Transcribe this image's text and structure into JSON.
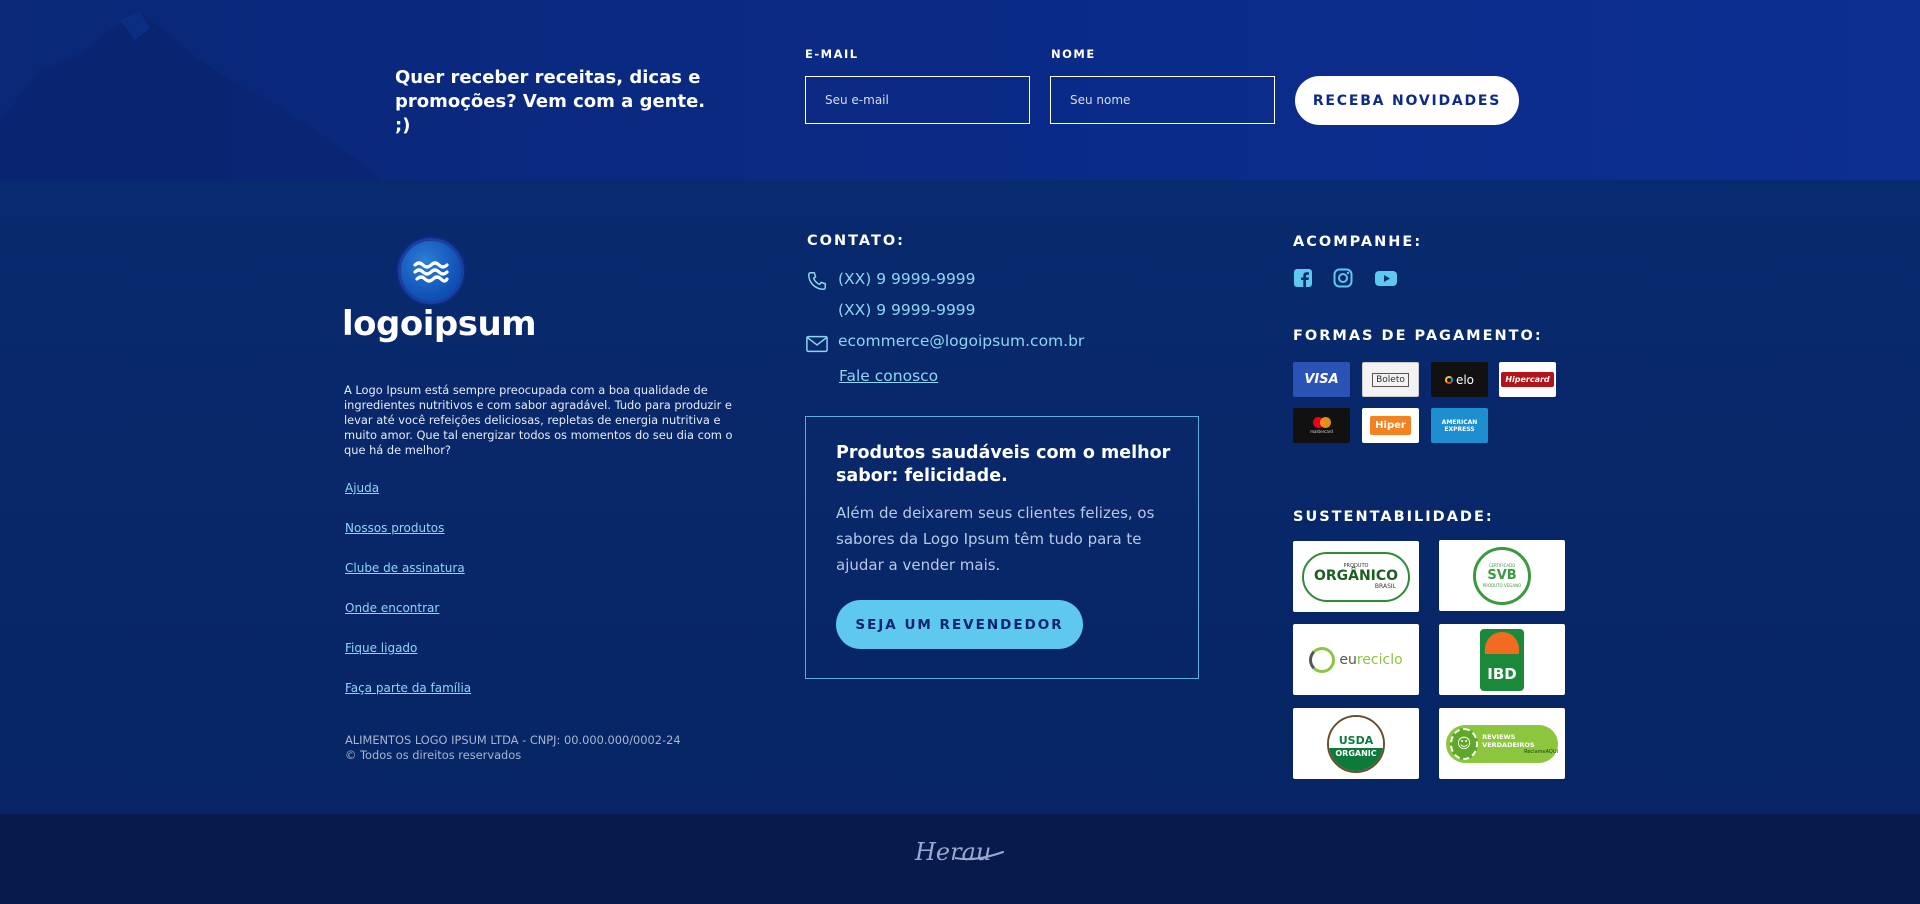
{
  "newsletter": {
    "title": "Quer receber receitas, dicas e promoções? Vem com a gente. ;)",
    "email_label": "E-MAIL",
    "email_placeholder": "Seu e-mail",
    "name_label": "NOME",
    "name_placeholder": "Seu nome",
    "submit_label": "RECEBA NOVIDADES"
  },
  "brand": {
    "logo_text": "logoipsum",
    "about": "A Logo Ipsum está sempre preocupada com a boa qualidade de ingredientes nutritivos e com sabor agradável. Tudo para produzir e levar até você refeições deliciosas, repletas de energia nutritiva e muito amor. Que tal energizar todos os momentos do seu dia com o que há de melhor?",
    "links": [
      "Ajuda",
      "Nossos produtos",
      "Clube de assinatura",
      "Onde encontrar",
      "Fique ligado",
      "Faça parte da família"
    ],
    "legal_line1": "ALIMENTOS LOGO IPSUM LTDA - CNPJ: 00.000.000/0002-24",
    "legal_line2": "© Todos os direitos reservados"
  },
  "contact": {
    "title": "CONTATO:",
    "phone1": "(XX) 9 9999-9999",
    "phone2": "(XX) 9 9999-9999",
    "email": "ecommerce@logoipsum.com.br",
    "fale_conosco": "Fale conosco"
  },
  "promo": {
    "title": "Produtos saudáveis com o melhor sabor: felicidade.",
    "text": "Além de deixarem seus clientes felizes, os sabores da Logo Ipsum têm tudo para te ajudar a vender mais.",
    "button": "SEJA UM REVENDEDOR"
  },
  "social": {
    "title": "ACOMPANHE:",
    "icons": [
      "facebook-icon",
      "instagram-icon",
      "youtube-icon"
    ]
  },
  "payments": {
    "title": "FORMAS DE PAGAMENTO:",
    "methods": [
      "VISA",
      "Boleto",
      "elo",
      "Hipercard",
      "mastercard",
      "Hiper",
      "AMERICAN EXPRESS"
    ]
  },
  "sustainability": {
    "title": "SUSTENTABILIDADE:",
    "seals": {
      "organico_small": "PRODUTO",
      "organico_main": "ORGÂNICO",
      "organico_sub": "BRASIL",
      "vegano_top": "CERTIFICADO",
      "vegano_mark": "SVB",
      "vegano_bottom": "PRODUTO VEGANO",
      "eureciclo_a": "eu",
      "eureciclo_b": "reciclo",
      "ibd": "IBD",
      "usda_line1": "USDA",
      "usda_line2": "ORGANIC",
      "reviews": "REVIEWS VERDADEIROS",
      "reviews_sub": "ReclameAQUI"
    }
  },
  "bottom": {
    "signature": "Herau"
  },
  "colors": {
    "newsletter_bg": "#0a2a86",
    "footer_bg": "#082a6e",
    "accent": "#5ec8ee",
    "link": "#8ed6f3"
  }
}
